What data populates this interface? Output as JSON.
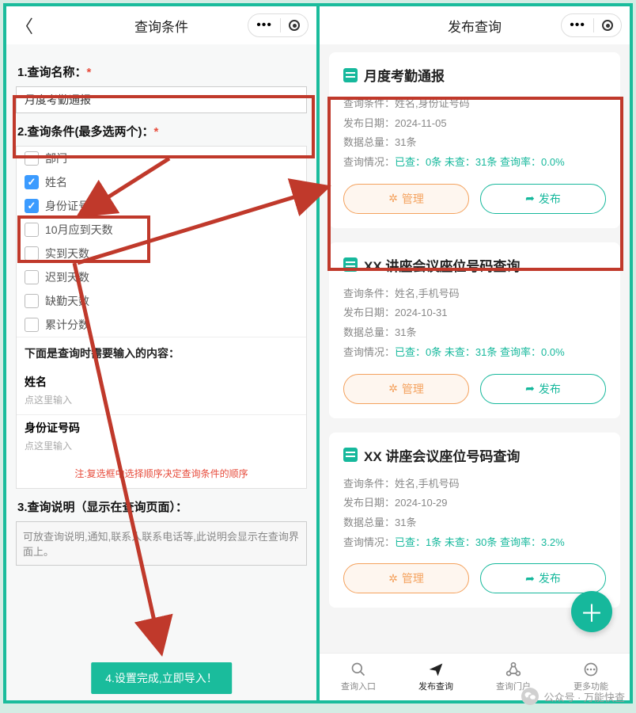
{
  "left": {
    "header_title": "查询条件",
    "section1_label": "1.查询名称：",
    "query_name_value": "月度考勤通报",
    "section2_label": "2.查询条件(最多选两个)：",
    "checks": [
      {
        "label": "部门",
        "checked": false
      },
      {
        "label": "姓名",
        "checked": true
      },
      {
        "label": "身份证号码",
        "checked": true
      },
      {
        "label": "10月应到天数",
        "checked": false
      },
      {
        "label": "实到天数",
        "checked": false
      },
      {
        "label": "迟到天数",
        "checked": false
      },
      {
        "label": "缺勤天数",
        "checked": false
      },
      {
        "label": "累计分数",
        "checked": false
      }
    ],
    "subheader": "下面是查询时需要输入的内容：",
    "inputs": [
      {
        "label": "姓名",
        "placeholder": "点这里输入"
      },
      {
        "label": "身份证号码",
        "placeholder": "点这里输入"
      }
    ],
    "note": "注:复选框中选择顺序决定查询条件的顺序",
    "section3_label": "3.查询说明（显示在查询页面）：",
    "desc_placeholder": "可放查询说明,通知,联系人联系电话等,此说明会显示在查询界面上。",
    "import_btn": "4.设置完成,立即导入！"
  },
  "right": {
    "header_title": "发布查询",
    "cards": [
      {
        "title": "月度考勤通报",
        "cond_label": "查询条件：",
        "cond": "姓名,身份证号码",
        "date_label": "发布日期：",
        "date": "2024-11-05",
        "total_label": "数据总量：",
        "total": "31条",
        "stat_label": "查询情况：",
        "stat_checked_lbl": "已查：",
        "stat_checked": "0条",
        "stat_unchecked_lbl": "未查：",
        "stat_unchecked": "31条",
        "rate_lbl": "查询率：",
        "rate": "0.0%",
        "manage": "管理",
        "publish": "发布"
      },
      {
        "title": "XX 讲座会议座位号码查询",
        "cond_label": "查询条件：",
        "cond": "姓名,手机号码",
        "date_label": "发布日期：",
        "date": "2024-10-31",
        "total_label": "数据总量：",
        "total": "31条",
        "stat_label": "查询情况：",
        "stat_checked_lbl": "已查：",
        "stat_checked": "0条",
        "stat_unchecked_lbl": "未查：",
        "stat_unchecked": "31条",
        "rate_lbl": "查询率：",
        "rate": "0.0%",
        "manage": "管理",
        "publish": "发布"
      },
      {
        "title": "XX 讲座会议座位号码查询",
        "cond_label": "查询条件：",
        "cond": "姓名,手机号码",
        "date_label": "发布日期：",
        "date": "2024-10-29",
        "total_label": "数据总量：",
        "total": "31条",
        "stat_label": "查询情况：",
        "stat_checked_lbl": "已查：",
        "stat_checked": "1条",
        "stat_unchecked_lbl": "未查：",
        "stat_unchecked": "30条",
        "rate_lbl": "查询率：",
        "rate": "3.2%",
        "manage": "管理",
        "publish": "发布"
      }
    ],
    "tabs": [
      {
        "label": "查询入口"
      },
      {
        "label": "发布查询"
      },
      {
        "label": "查询门户"
      },
      {
        "label": "更多功能"
      }
    ]
  },
  "watermark": "公众号 · 万能快查"
}
